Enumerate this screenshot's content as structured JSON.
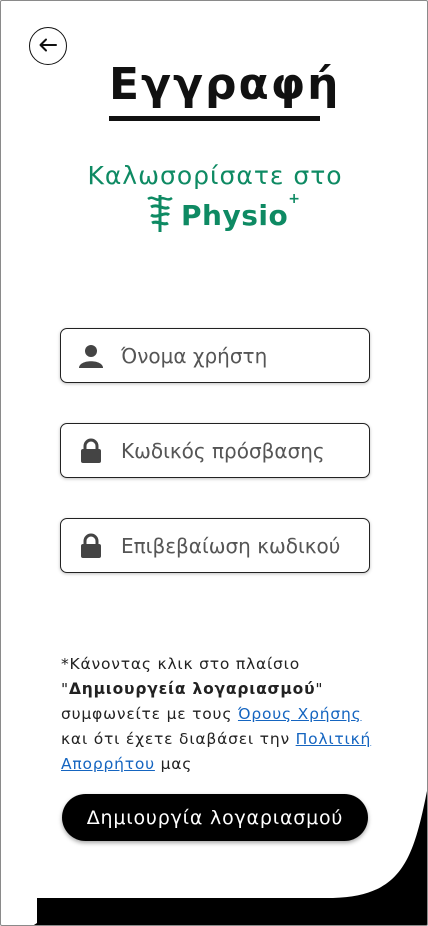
{
  "header": {
    "back_icon": "arrow-left-icon",
    "title": "Εγγραφή"
  },
  "welcome": {
    "text": "Καλωσορίσατε στο",
    "brand_name": "Physio",
    "brand_suffix": "+",
    "brand_icon": "caduceus-icon",
    "brand_color": "#0e8a63"
  },
  "form": {
    "username": {
      "placeholder": "Όνομα χρήστη",
      "icon": "user-icon"
    },
    "password": {
      "placeholder": "Κωδικός πρόσβασης",
      "icon": "lock-icon"
    },
    "confirm_password": {
      "placeholder": "Επιβεβαίωση κωδικού",
      "icon": "lock-icon"
    }
  },
  "terms": {
    "part1": "*Κάνοντας κλικ στο πλαίσιο",
    "quote_open": "\"",
    "bold": "Δημιουργεία λογαριασμού",
    "quote_close": "\"",
    "part2": " συμφωνείτε με τους ",
    "terms_link": "Όρους Χρήσης",
    "part3": " και ότι έχετε διαβάσει την ",
    "privacy_link": "Πολιτική Απορρήτου",
    "part4": " μας"
  },
  "create_button": {
    "label": "Δημιουργία λογαριασμού"
  },
  "colors": {
    "accent": "#0e8a63",
    "link": "#1565c0",
    "button": "#000000"
  }
}
